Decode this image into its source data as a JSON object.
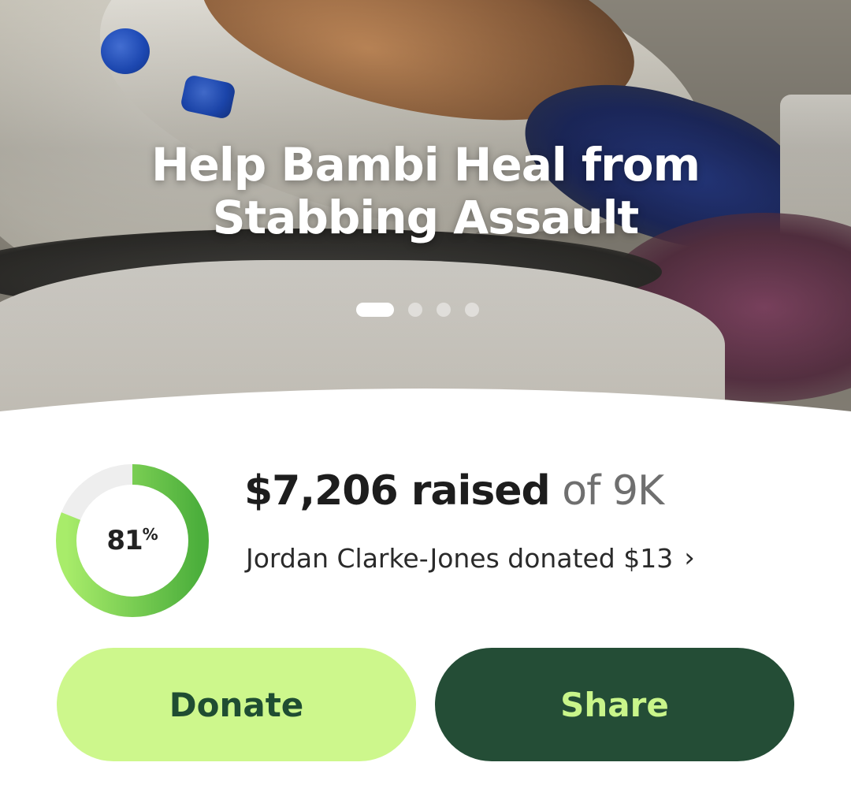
{
  "hero": {
    "title_line1": "Help Bambi Heal from",
    "title_line2": "Stabbing Assault",
    "carousel": {
      "total_slides": 4,
      "active_slide": 1
    }
  },
  "progress": {
    "fraction": 0.81,
    "percent_number": "81",
    "percent_sign": "%",
    "ring_colors": {
      "track": "#eeeeee",
      "fill_start": "#a8ec6a",
      "fill_end": "#4caf3c"
    }
  },
  "fundraiser": {
    "raised_amount": "$7,206 raised",
    "goal_text": "of 9K",
    "recent_donation": "Jordan Clarke-Jones donated $13"
  },
  "actions": {
    "donate_label": "Donate",
    "share_label": "Share"
  },
  "colors": {
    "donate_bg": "#cdf78c",
    "donate_text": "#1f4d32",
    "share_bg": "#244d36",
    "share_text": "#c9f58a"
  },
  "icons": {
    "donation_chevron": "chevron-right-icon"
  }
}
